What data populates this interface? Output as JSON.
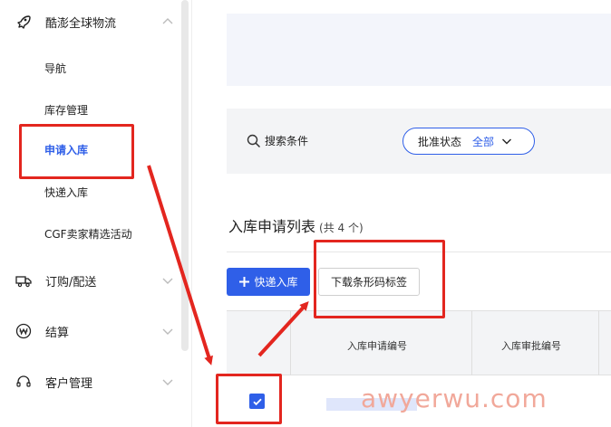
{
  "sidebar": {
    "group_main": "酷澎全球物流",
    "items": [
      "导航",
      "库存管理",
      "申请入库",
      "快递入库",
      "CGF卖家精选活动"
    ],
    "group_order": "订购/配送",
    "group_settle": "结算",
    "group_customer": "客户管理"
  },
  "search": {
    "label": "搜索条件",
    "status_key": "批准状态",
    "status_value": "全部"
  },
  "list": {
    "title": "入库申请列表",
    "count": "(共 4 个)"
  },
  "toolbar": {
    "express_label": "快递入库",
    "barcode_label": "下载条形码标签"
  },
  "table": {
    "columns": [
      "入库申请编号",
      "入库审批编号"
    ]
  },
  "watermark": "awyerwu.com",
  "colors": {
    "accent": "#2f5fe8",
    "highlight": "#e3261f"
  }
}
